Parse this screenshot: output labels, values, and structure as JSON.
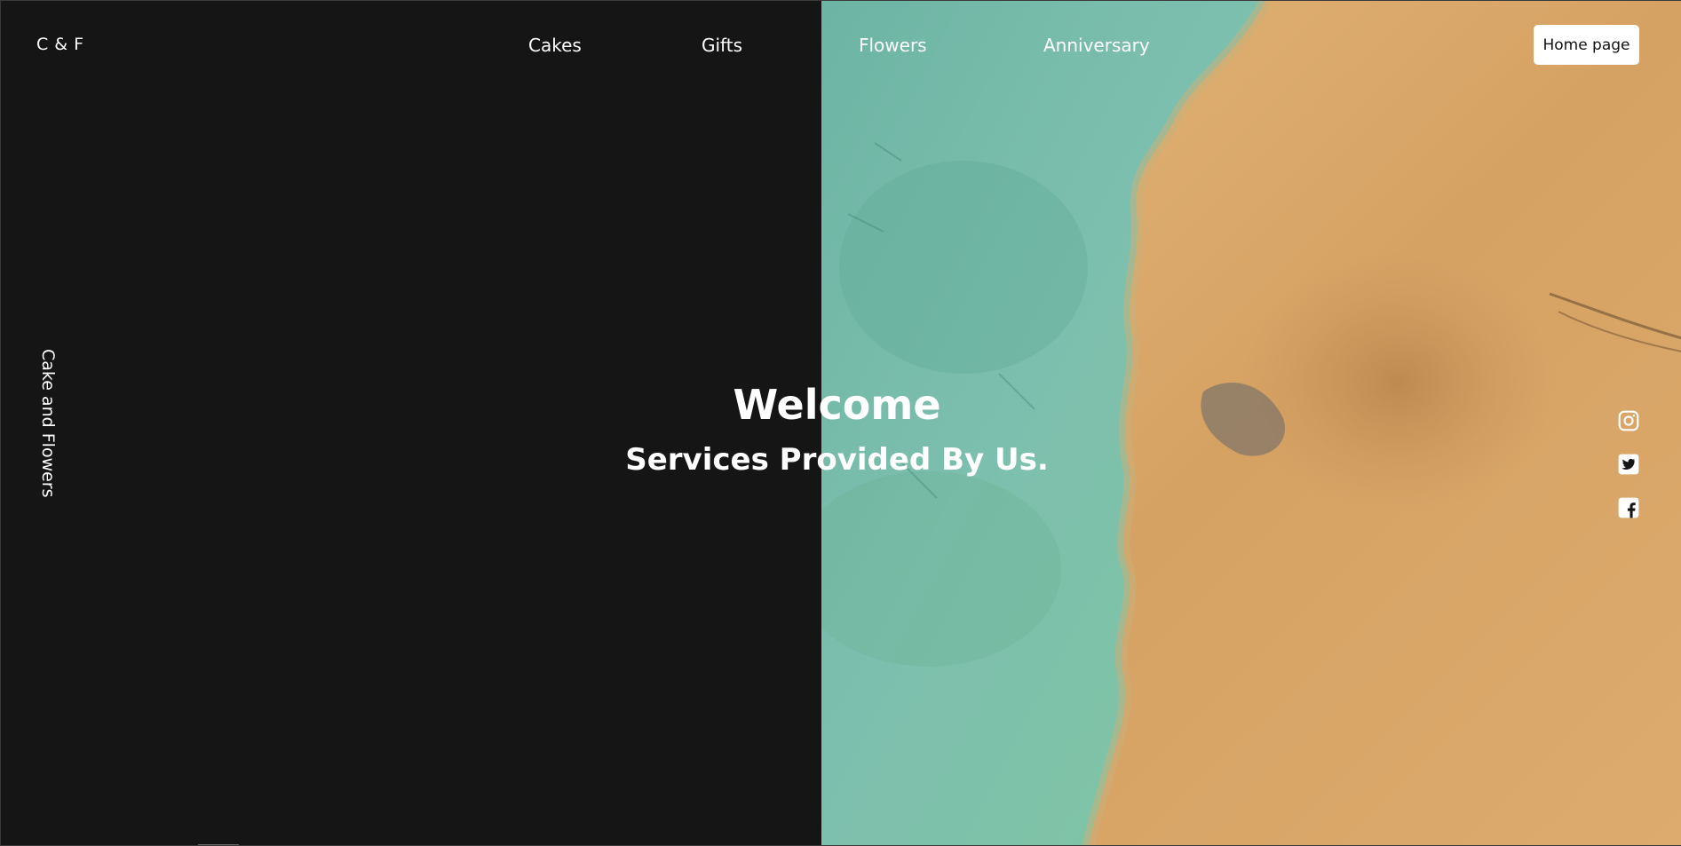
{
  "header": {
    "brand": "C & F",
    "nav": [
      {
        "label": "Cakes"
      },
      {
        "label": "Gifts"
      },
      {
        "label": "Flowers"
      },
      {
        "label": "Anniversary"
      }
    ],
    "home_button": "Home page"
  },
  "sidebar": {
    "vertical_label": "Cake and Flowers"
  },
  "hero": {
    "title": "Welcome",
    "subtitle": "Services Provided By Us."
  },
  "social": [
    {
      "icon": "instagram-icon"
    },
    {
      "icon": "twitter-icon"
    },
    {
      "icon": "facebook-icon"
    }
  ],
  "colors": {
    "background": "#151515",
    "text": "#ffffff",
    "button_bg": "#ffffff",
    "water": "#6fb7a3",
    "sand": "#d9a767"
  }
}
